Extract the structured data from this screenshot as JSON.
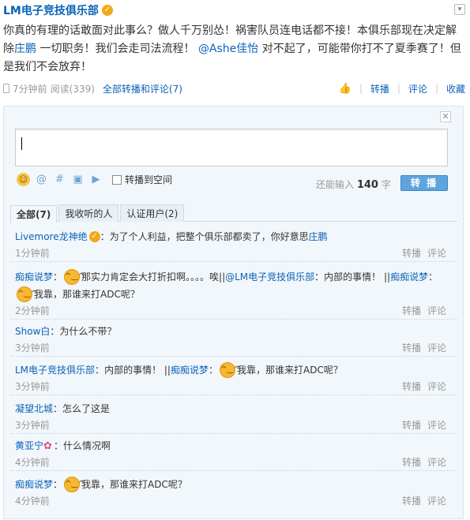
{
  "post": {
    "author": "LM电子竞技俱乐部",
    "text_part1": "你真的有理的话敢面对此事么？做人千万别怂！祸害队员连电话都不接！本俱乐部现在决定解除",
    "mention_link": "庄鹏",
    "text_part2": " 一切职务！我们会走司法流程！ ",
    "at_user": "@Ashe佳怡",
    "text_part3": " 对不起了，可能带你打不了夏季赛了！但是我们不会放弃！",
    "time": "7分钟前",
    "reads": "阅读(339)",
    "all_reposts_comments": "全部转播和评论(7)",
    "actions": {
      "repost": "转播",
      "comment": "评论",
      "favorite": "收藏"
    }
  },
  "compose": {
    "tools": [
      "smile-icon",
      "at-icon",
      "hashtag-icon",
      "image-icon",
      "video-icon"
    ],
    "repost_to_space": "转播到空间",
    "remaining_prefix": "还能输入",
    "remaining_count": "140",
    "remaining_suffix": "字",
    "submit": "转 播"
  },
  "tabs": [
    "全部(7)",
    "我收听的人",
    "认证用户(2)"
  ],
  "comments": [
    {
      "user": "Livemore龙神绝",
      "badge": true,
      "text": "为了个人利益，把整个俱乐部都卖了，你好意思",
      "link": "庄鹏",
      "time": "1分钟前"
    },
    {
      "user": "痴痴说梦",
      "text1": "那实力肯定会大打折扣啊。。。。唉||",
      "user2": "@LM电子竞技俱乐部",
      "text2": "：内部的事情！ || ",
      "user3": "痴痴说梦",
      "text3": "我靠，那谁来打ADC呢？",
      "time": "2分钟前"
    },
    {
      "user": "Show白",
      "text": "为什么不带？",
      "time": "3分钟前"
    },
    {
      "user": "LM电子竞技俱乐部",
      "text1": "内部的事情！ || ",
      "user2": "痴痴说梦",
      "text2": "我靠，那谁来打ADC呢？",
      "time": "3分钟前"
    },
    {
      "user": "凝望北城",
      "text": "怎么了这是",
      "time": "3分钟前"
    },
    {
      "user": "黄亚宁",
      "text": "什么情况啊",
      "time": "4分钟前"
    },
    {
      "user": "痴痴说梦",
      "text": "我靠，那谁来打ADC呢？",
      "time": "4分钟前"
    }
  ],
  "comment_actions": {
    "repost": "转播",
    "comment": "评论"
  },
  "colors": {
    "link": "#0a63b7",
    "submit_bg": "#5ea5df",
    "panel_bg": "#f2f7fb"
  }
}
